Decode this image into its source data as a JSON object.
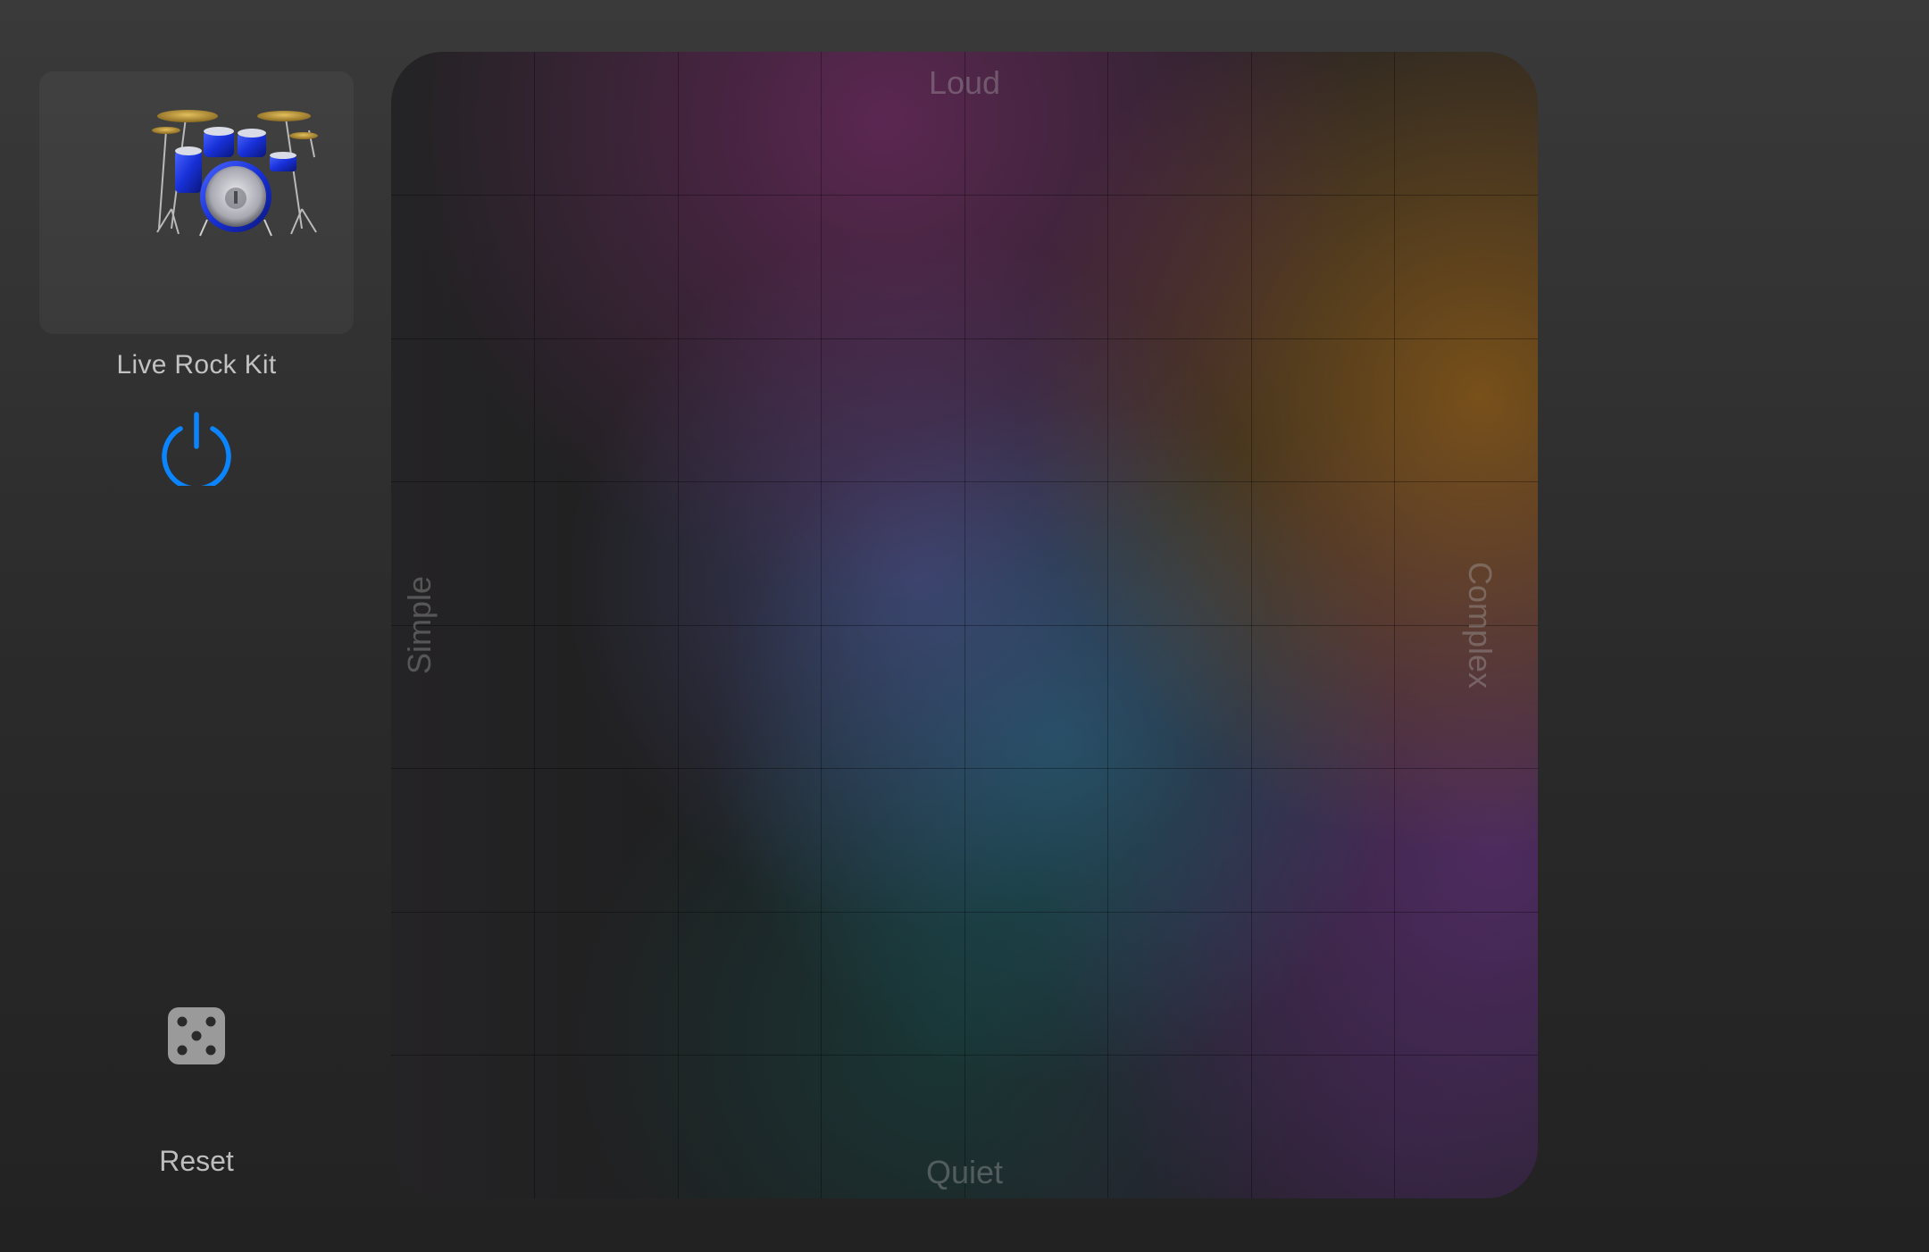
{
  "drummer": {
    "kit_name": "Live Rock Kit",
    "kit_icon": "drum-kit-image"
  },
  "controls": {
    "power_icon": "power-icon",
    "power_state": "on",
    "accent_color": "#0a84ff",
    "dice_icon": "dice-five-icon",
    "reset_label": "Reset"
  },
  "xy_pad": {
    "top_label": "Loud",
    "bottom_label": "Quiet",
    "left_label": "Simple",
    "right_label": "Complex",
    "grid_divisions": 8
  }
}
